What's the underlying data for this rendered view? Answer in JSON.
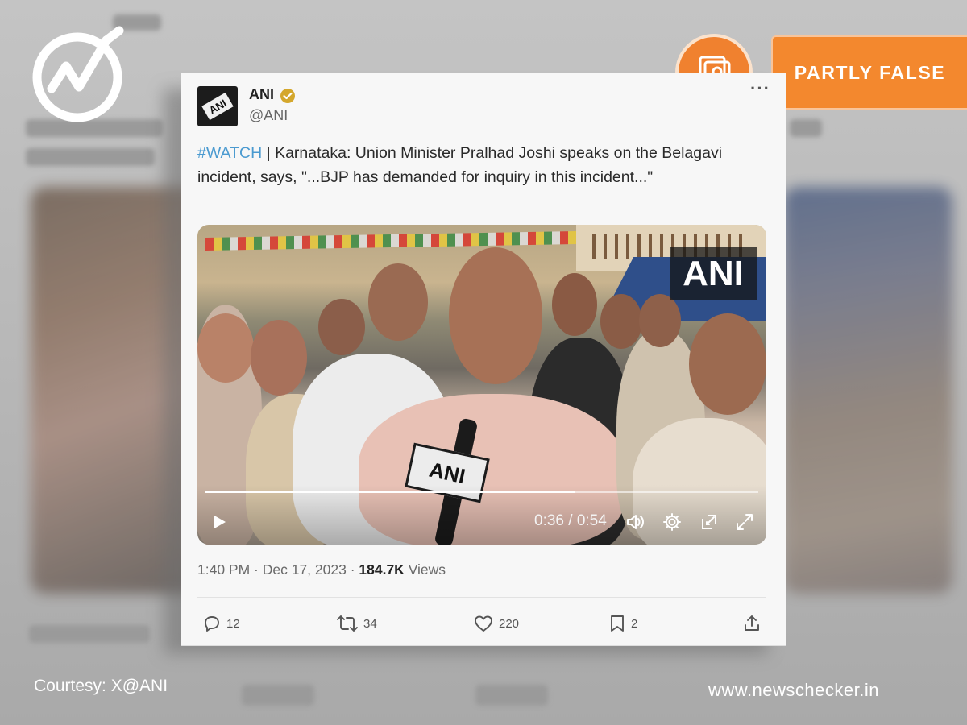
{
  "badge": {
    "verdict": "PARTLY FALSE",
    "icon": "profile-frame-icon",
    "color": "#f3882e"
  },
  "logo": {
    "icon": "newschecker-check-logo"
  },
  "tweet": {
    "author_name": "ANI",
    "author_handle": "@ANI",
    "avatar_text": "ANI",
    "hashtag": "#WATCH",
    "text": " | Karnataka: Union Minister Pralhad Joshi speaks on the Belagavi incident, says, \"...BJP has demanded for inquiry in this incident...\"",
    "video": {
      "watermark": "ANI",
      "mic_flag": "ANI",
      "current_time": "0:36",
      "duration": "0:54",
      "time_label": "0:36 / 0:54",
      "progress_fraction": 0.667
    },
    "timestamp": "1:40 PM · Dec 17, 2023 · ",
    "views_count": "184.7K",
    "views_label": " Views",
    "actions": {
      "replies": "12",
      "reposts": "34",
      "likes": "220",
      "bookmarks": "2"
    }
  },
  "footer": {
    "courtesy": "Courtesy: X@ANI",
    "site": "www.newschecker.in"
  },
  "colors": {
    "hashtag": "#4a9ad0",
    "badge_orange": "#f3882e"
  }
}
